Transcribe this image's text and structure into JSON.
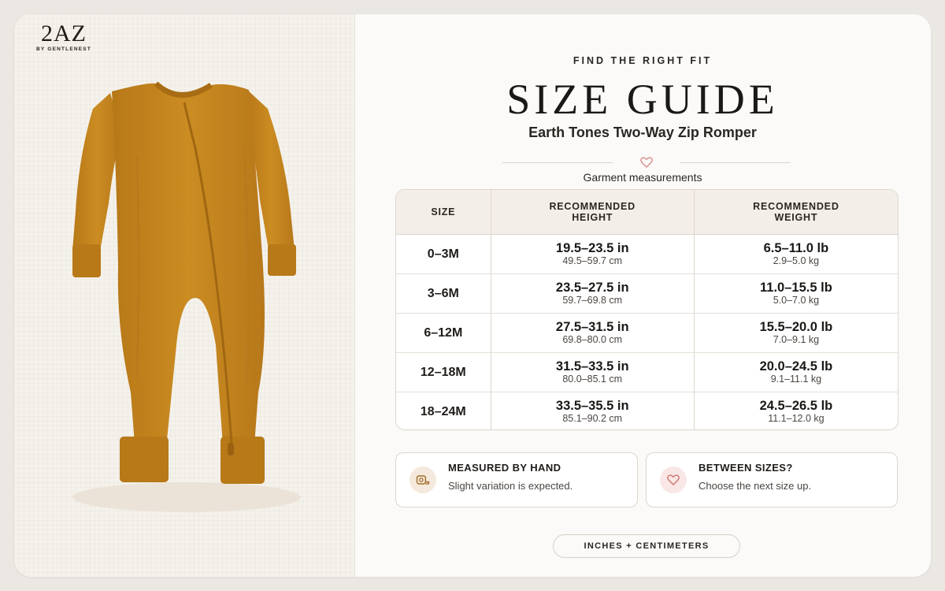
{
  "brand": {
    "name": "2AZ",
    "tagline": "BY GENTLENEST"
  },
  "header": {
    "eyebrow": "FIND THE RIGHT FIT",
    "title": "SIZE GUIDE",
    "product": "Earth Tones Two-Way Zip Romper",
    "caption": "Garment measurements"
  },
  "table": {
    "headers": {
      "size": "SIZE",
      "height_1": "RECOMMENDED",
      "height_2": "HEIGHT",
      "weight_1": "RECOMMENDED",
      "weight_2": "WEIGHT"
    },
    "rows": [
      {
        "size": "0–3M",
        "height_in": "19.5–23.5 in",
        "height_cm": "49.5–59.7 cm",
        "weight_lb": "6.5–11.0 lb",
        "weight_kg": "2.9–5.0 kg"
      },
      {
        "size": "3–6M",
        "height_in": "23.5–27.5 in",
        "height_cm": "59.7–69.8 cm",
        "weight_lb": "11.0–15.5 lb",
        "weight_kg": "5.0–7.0 kg"
      },
      {
        "size": "6–12M",
        "height_in": "27.5–31.5 in",
        "height_cm": "69.8–80.0 cm",
        "weight_lb": "15.5–20.0 lb",
        "weight_kg": "7.0–9.1 kg"
      },
      {
        "size": "12–18M",
        "height_in": "31.5–33.5 in",
        "height_cm": "80.0–85.1 cm",
        "weight_lb": "20.0–24.5 lb",
        "weight_kg": "9.1–11.1 kg"
      },
      {
        "size": "18–24M",
        "height_in": "33.5–35.5 in",
        "height_cm": "85.1–90.2 cm",
        "weight_lb": "24.5–26.5 lb",
        "weight_kg": "11.1–12.0 kg"
      }
    ]
  },
  "notes": [
    {
      "icon": "tape-measure-icon",
      "title": "MEASURED BY HAND",
      "text": "Slight variation is expected."
    },
    {
      "icon": "heart-icon",
      "title": "BETWEEN SIZES?",
      "text": "Choose the next size up."
    }
  ],
  "units_toggle": "INCHES + CENTIMETERS",
  "colors": {
    "romper": "#c98a1f",
    "accent_heart": "#d98a8a",
    "background": "#ebe7e2"
  }
}
